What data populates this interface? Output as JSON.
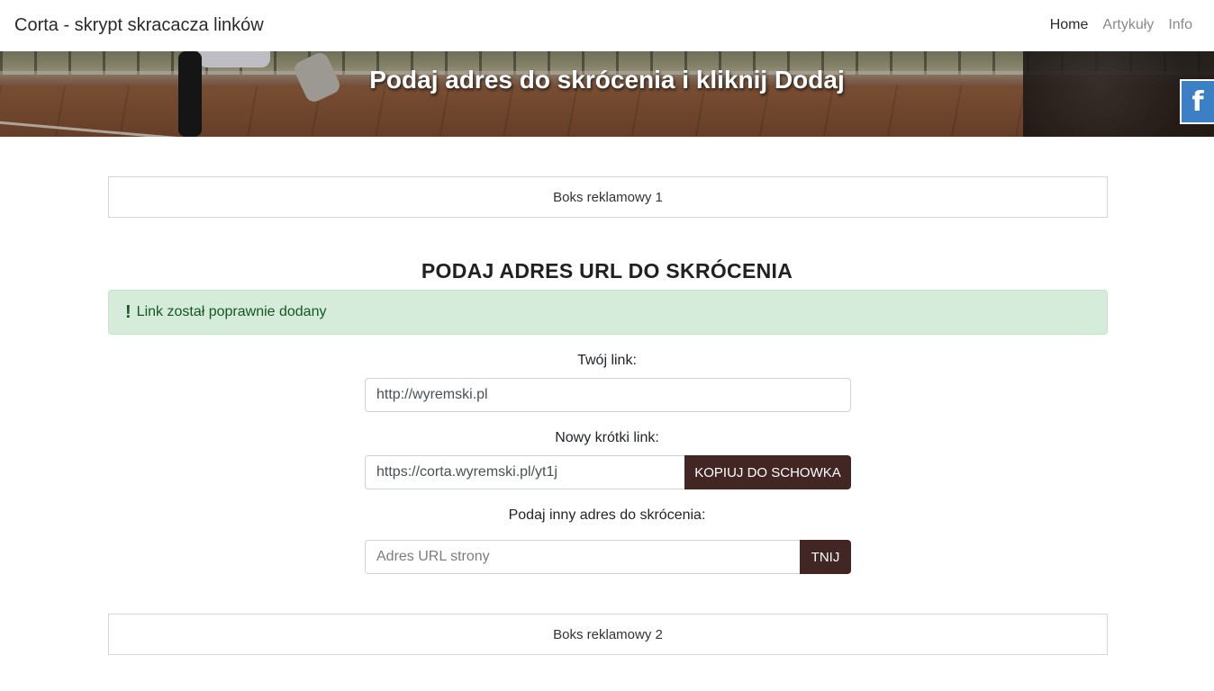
{
  "navbar": {
    "brand": "Corta - skrypt skracacza linków",
    "items": [
      {
        "label": "Home",
        "active": true
      },
      {
        "label": "Artykuły",
        "active": false
      },
      {
        "label": "Info",
        "active": false
      }
    ]
  },
  "hero": {
    "title": "Podaj adres do skrócenia i kliknij Dodaj"
  },
  "social": {
    "facebook_glyph": "f",
    "icon": "facebook-icon",
    "color": "#3b7fc4"
  },
  "ads": {
    "box1": "Boks reklamowy 1",
    "box2": "Boks reklamowy 2"
  },
  "main": {
    "title": "PODAJ ADRES URL DO SKRÓCENIA",
    "alert": {
      "icon": "!",
      "text": "Link został poprawnie dodany",
      "color": "#d4ecd9"
    },
    "your_link": {
      "label": "Twój link:",
      "value": "http://wyremski.pl"
    },
    "short_link": {
      "label": "Nowy krótki link:",
      "value": "https://corta.wyremski.pl/yt1j",
      "button": "KOPIUJ DO SCHOWKA"
    },
    "another": {
      "label": "Podaj inny adres do skrócenia:",
      "placeholder": "Adres URL strony",
      "button": "TNIJ"
    },
    "button_color": "#412624"
  }
}
